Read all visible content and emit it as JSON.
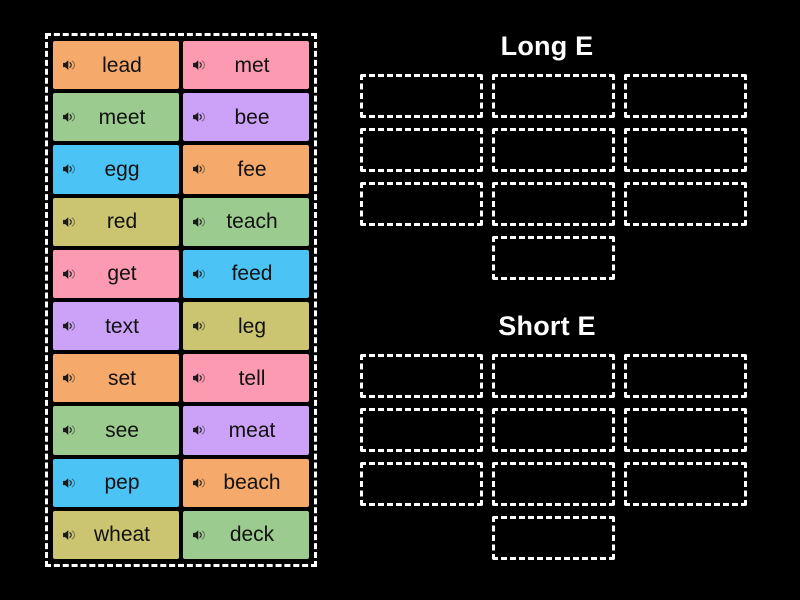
{
  "page": {
    "background_color": "#000000",
    "activity_type": "word-sort-drag-and-drop"
  },
  "word_bank": {
    "name": "word-bank",
    "icon_name": "speaker-icon",
    "tiles": [
      {
        "word": "lead",
        "color": "#f5a96a",
        "icon": "speaker-icon"
      },
      {
        "word": "met",
        "color": "#fb9ab0",
        "icon": "speaker-icon"
      },
      {
        "word": "meet",
        "color": "#9ccb8f",
        "icon": "speaker-icon"
      },
      {
        "word": "bee",
        "color": "#cba2f7",
        "icon": "speaker-icon"
      },
      {
        "word": "egg",
        "color": "#4cc3f5",
        "icon": "speaker-icon"
      },
      {
        "word": "fee",
        "color": "#f5a96a",
        "icon": "speaker-icon"
      },
      {
        "word": "red",
        "color": "#cbc471",
        "icon": "speaker-icon"
      },
      {
        "word": "teach",
        "color": "#9ccb8f",
        "icon": "speaker-icon"
      },
      {
        "word": "get",
        "color": "#fb9ab0",
        "icon": "speaker-icon"
      },
      {
        "word": "feed",
        "color": "#4cc3f5",
        "icon": "speaker-icon"
      },
      {
        "word": "text",
        "color": "#cba2f7",
        "icon": "speaker-icon"
      },
      {
        "word": "leg",
        "color": "#cbc471",
        "icon": "speaker-icon"
      },
      {
        "word": "set",
        "color": "#f5a96a",
        "icon": "speaker-icon"
      },
      {
        "word": "tell",
        "color": "#fb9ab0",
        "icon": "speaker-icon"
      },
      {
        "word": "see",
        "color": "#9ccb8f",
        "icon": "speaker-icon"
      },
      {
        "word": "meat",
        "color": "#cba2f7",
        "icon": "speaker-icon"
      },
      {
        "word": "pep",
        "color": "#4cc3f5",
        "icon": "speaker-icon"
      },
      {
        "word": "beach",
        "color": "#f5a96a",
        "icon": "speaker-icon"
      },
      {
        "word": "wheat",
        "color": "#cbc471",
        "icon": "speaker-icon"
      },
      {
        "word": "deck",
        "color": "#9ccb8f",
        "icon": "speaker-icon"
      }
    ]
  },
  "categories": [
    {
      "id": "long-e",
      "title": "Long E",
      "slot_count": 10,
      "grid_slots": 9,
      "extra_slots": 1,
      "filled": []
    },
    {
      "id": "short-e",
      "title": "Short E",
      "slot_count": 10,
      "grid_slots": 9,
      "extra_slots": 1,
      "filled": []
    }
  ],
  "colors": {
    "background": "#000000",
    "dashed_border": "#ffffff",
    "title_text": "#ffffff",
    "tile_text": "#111111",
    "orange": "#f5a96a",
    "pink": "#fb9ab0",
    "green": "#9ccb8f",
    "purple": "#cba2f7",
    "blue": "#4cc3f5",
    "olive": "#cbc471"
  }
}
